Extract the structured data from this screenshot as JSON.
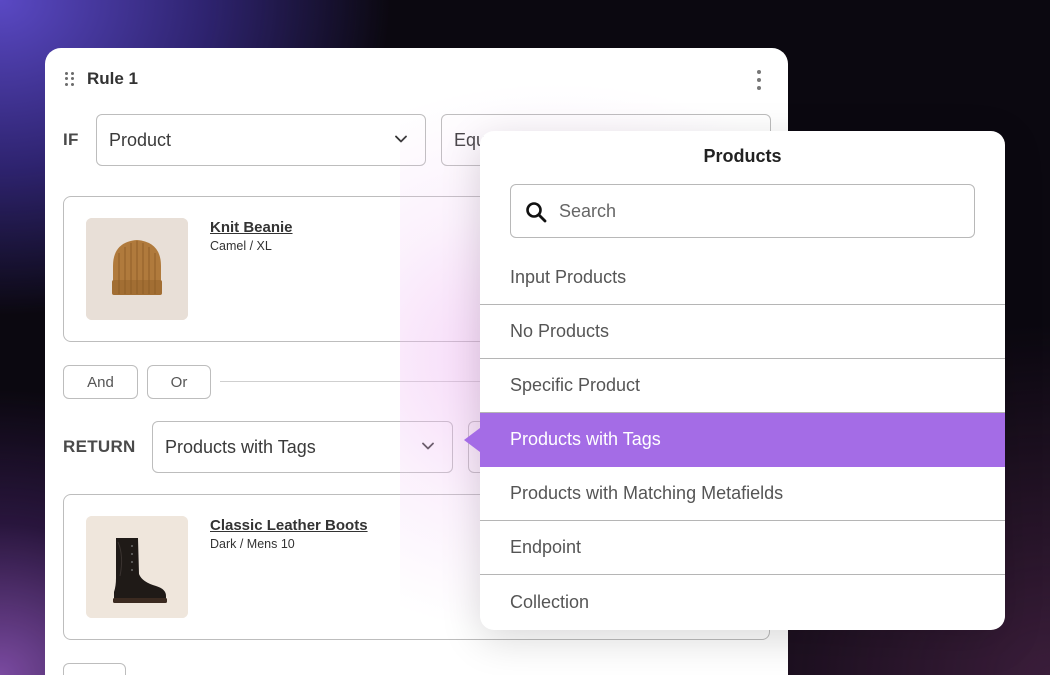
{
  "rule": {
    "title": "Rule 1",
    "if_keyword": "IF",
    "condition_select": "Product",
    "operator_select": "Equ",
    "condition_product": {
      "name": "Knit Beanie",
      "variant": "Camel / XL"
    },
    "and_label": "And",
    "or_label": "Or",
    "return_keyword": "RETURN",
    "return_select": "Products with Tags",
    "return_product": {
      "name": "Classic Leather Boots",
      "variant": "Dark / Mens 10"
    }
  },
  "dropdown": {
    "title": "Products",
    "search_placeholder": "Search",
    "items": [
      {
        "label": "Input Products",
        "selected": false
      },
      {
        "label": "No Products",
        "selected": false
      },
      {
        "label": "Specific Product",
        "selected": false
      },
      {
        "label": "Products with Tags",
        "selected": true
      },
      {
        "label": "Products with Matching Metafields",
        "selected": false
      },
      {
        "label": "Endpoint",
        "selected": false
      },
      {
        "label": "Collection",
        "selected": false
      }
    ]
  },
  "colors": {
    "accent": "#a46ce6",
    "background": "#0b0810",
    "card": "#ffffff"
  }
}
